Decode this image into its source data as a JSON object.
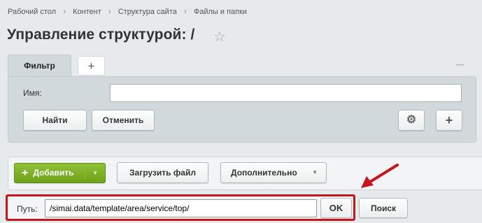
{
  "breadcrumb": {
    "items": [
      "Рабочий стол",
      "Контент",
      "Структура сайта",
      "Файлы и папки"
    ]
  },
  "page": {
    "title": "Управление структурой: /"
  },
  "filter": {
    "tab_label": "Фильтр",
    "add_tab_symbol": "+",
    "name_label": "Имя:",
    "name_value": "",
    "find_label": "Найти",
    "cancel_label": "Отменить",
    "add_field_symbol": "+"
  },
  "toolbar": {
    "add_label": "Добавить",
    "upload_label": "Загрузить файл",
    "more_label": "Дополнительно"
  },
  "path_bar": {
    "label": "Путь:",
    "value": "/simai.data/template/area/service/top/",
    "ok_label": "OK",
    "search_label": "Поиск"
  },
  "colors": {
    "accent_green": "#7ab02c",
    "highlight_red": "#c4161c",
    "page_bg": "#e6eaec"
  },
  "icons": [
    "star-icon",
    "plus-icon",
    "minus-icon",
    "gear-icon",
    "caret-down-icon",
    "arrow-annotation-icon"
  ]
}
